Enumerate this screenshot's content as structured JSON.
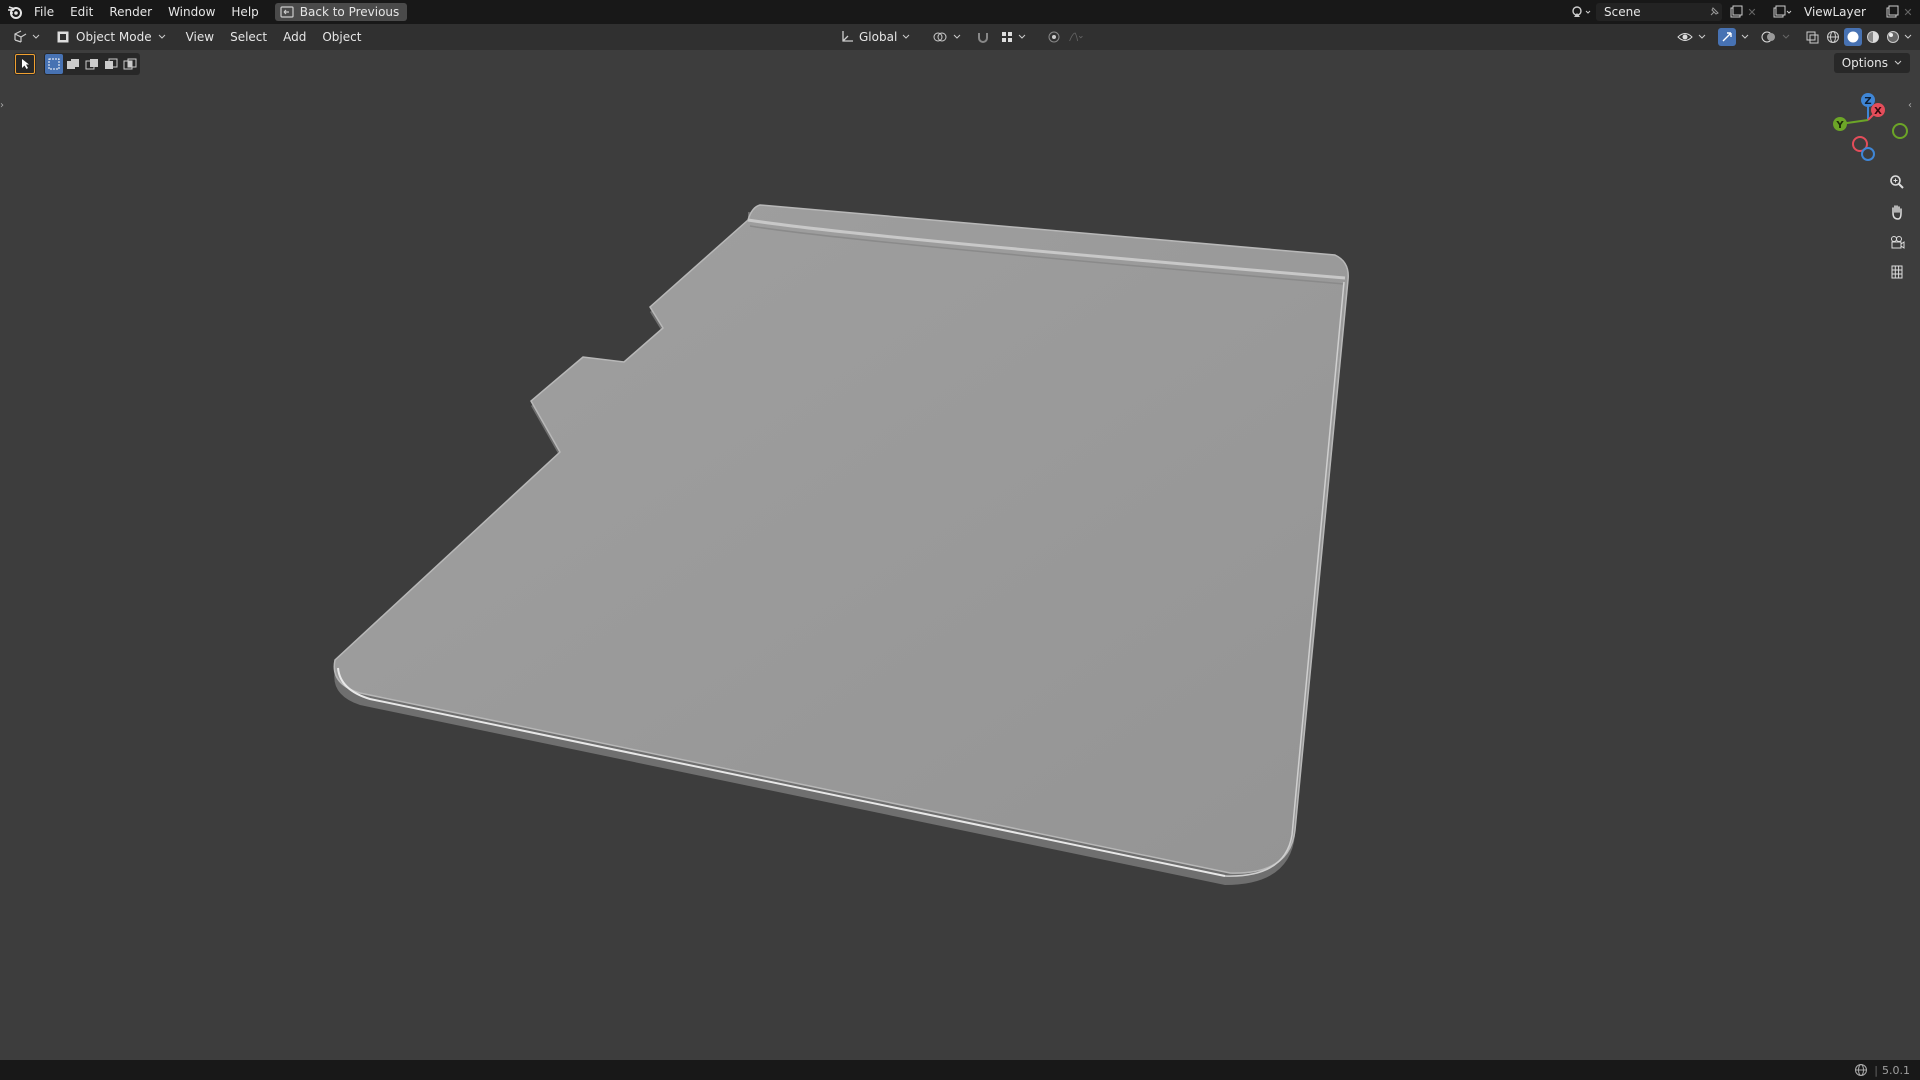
{
  "topbar": {
    "menus": [
      "File",
      "Edit",
      "Render",
      "Window",
      "Help"
    ],
    "back_label": "Back to Previous",
    "scene": "Scene",
    "view_layer": "ViewLayer"
  },
  "header": {
    "mode": "Object Mode",
    "menus": [
      "View",
      "Select",
      "Add",
      "Object"
    ],
    "orientation": "Global"
  },
  "viewport": {
    "options_label": "Options",
    "gizmo_axes": {
      "x": "X",
      "y": "Y",
      "z": "Z"
    },
    "nav_icons": [
      "zoom-icon",
      "pan-hand-icon",
      "camera-view-icon",
      "ortho-grid-icon"
    ]
  },
  "statusbar": {
    "version": "5.0.1"
  },
  "colors": {
    "accent": "#4772b3",
    "axis_x": "#e44d5a",
    "axis_y": "#6ca527",
    "axis_z": "#3f86d6",
    "mesh": "#9a9a9a"
  }
}
